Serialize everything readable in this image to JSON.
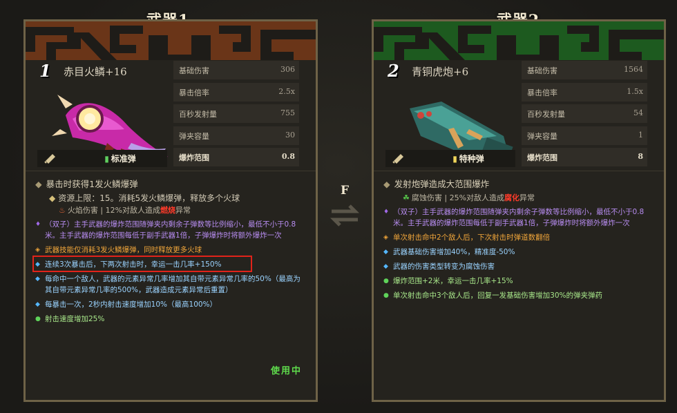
{
  "labels": {
    "base_damage": "基础伤害",
    "crit_multiplier": "暴击倍率",
    "fire_rate": "百秒发射量",
    "mag_size": "弹夹容量",
    "explosion_range": "爆炸范围"
  },
  "swap": {
    "key": "F"
  },
  "weapon1": {
    "title": "武器1",
    "slot": "1",
    "name": "赤目火鳞+16",
    "ammo": "标准弹",
    "banner_color": "#6a3518",
    "stats": {
      "base_damage": "306",
      "crit_multiplier": "2.5x",
      "fire_rate": "755",
      "mag_size": "30",
      "explosion_range": "0.8"
    },
    "main_effect": "暴击时获得1发火鳞爆弹",
    "resource_line": "资源上限：15。消耗5发火鳞爆弹，释放多个火球",
    "element": {
      "prefix": "火焰伤害 | 12%对敌人造成",
      "highlight": "燃烧",
      "suffix": "异常"
    },
    "traits": [
      "（双子）主手武器的爆炸范围随弹夹内剩余子弹数等比例缩小，最低不小于0.8米。主手武器的爆炸范围每低于副手武器1倍，子弹爆炸时将额外爆炸一次",
      "武器技能仅消耗3发火鳞爆弹，同时释放更多火球",
      "连续3次暴击后，下两次射击时，幸运一击几率+150%",
      "每命中一个敌人，武器的元素异常几率增加其自带元素异常几率的50%（最高为其自带元素异常几率的500%，武器造成元素异常后重置）",
      "每暴击一次，2秒内射击速度增加10%（最高100%）",
      "射击速度增加25%"
    ],
    "status": "使用中"
  },
  "weapon2": {
    "title": "武器2",
    "slot": "2",
    "name": "青铜虎炮+6",
    "ammo": "特种弹",
    "banner_color": "#1d5a1f",
    "stats": {
      "base_damage": "1564",
      "crit_multiplier": "1.5x",
      "fire_rate": "54",
      "mag_size": "1",
      "explosion_range": "8"
    },
    "main_effect": "发射炮弹造成大范围爆炸",
    "element": {
      "prefix": "腐蚀伤害 | 25%对敌人造成",
      "highlight": "腐化",
      "suffix": "异常"
    },
    "traits": [
      "（双子）主手武器的爆炸范围随弹夹内剩余子弹数等比例缩小，最低不小于0.8米。主手武器的爆炸范围每低于副手武器1倍，子弹爆炸时将额外爆炸一次",
      "单次射击命中2个敌人后，下次射击时弹道数翻倍",
      "武器基础伤害增加40%，精准度-50%",
      "武器的伤害类型转变为腐蚀伤害",
      "爆炸范围+2米，幸运一击几率+15%",
      "单次射击命中3个敌人后，回复一发基础伤害增加30%的弹夹弹药"
    ]
  }
}
